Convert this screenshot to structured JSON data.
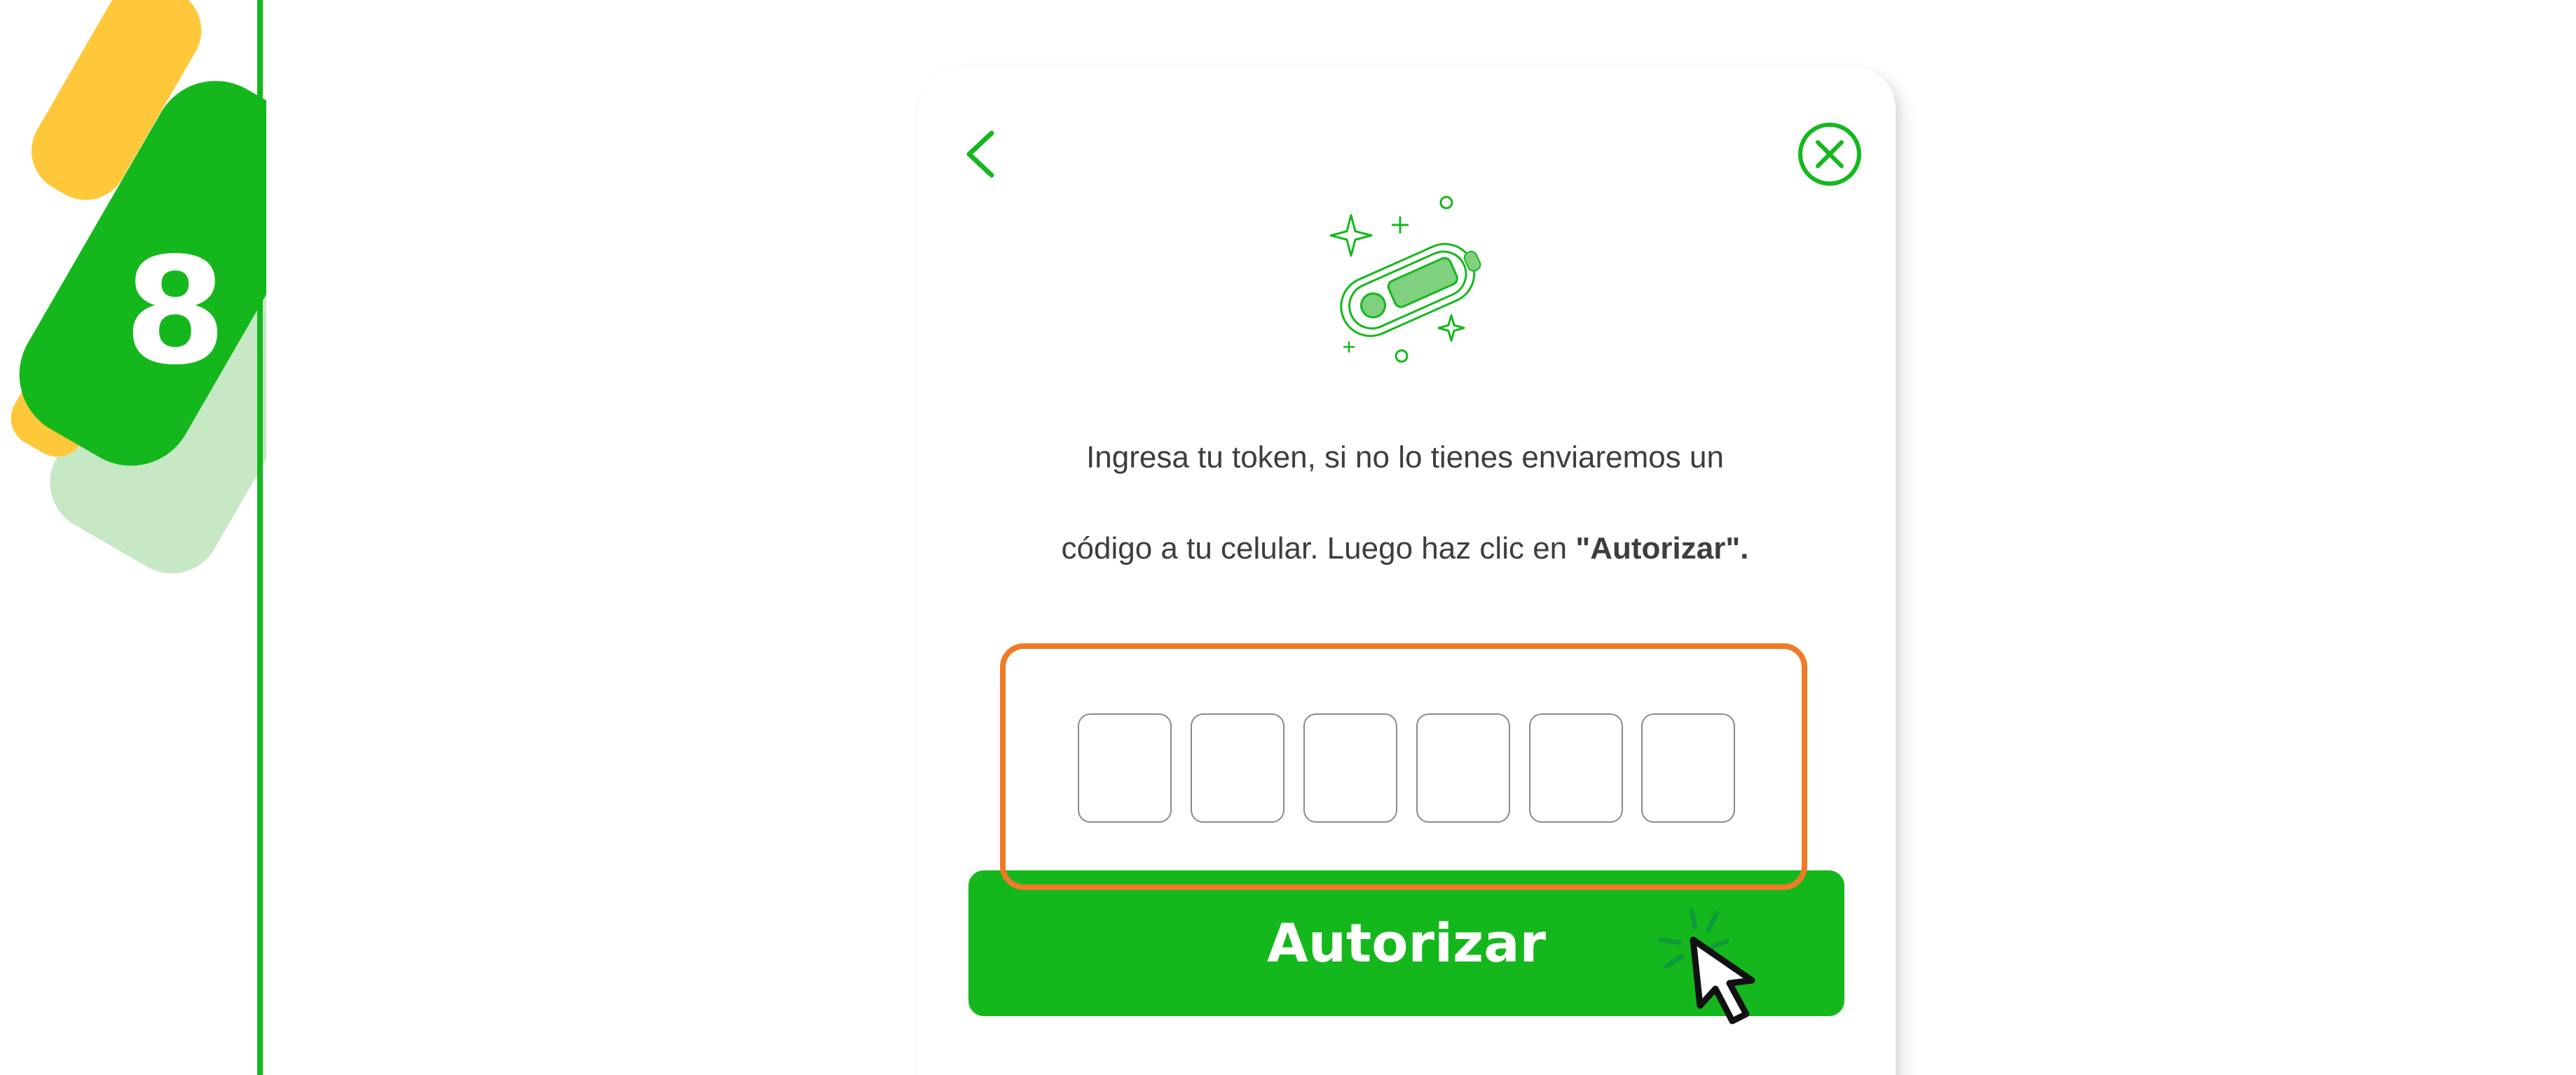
{
  "step": {
    "number": "8"
  },
  "dialog": {
    "instruction_line1": "Ingresa tu token, si no lo tienes enviaremos un",
    "instruction_line2": "código a tu celular. Luego haz clic en ",
    "instruction_bold": "\"Autorizar\".",
    "token_digits": [
      "",
      "",
      "",
      "",
      "",
      ""
    ],
    "authorize_label": "Autorizar"
  },
  "icons": {
    "back": "chevron-left-icon",
    "close": "close-circle-icon",
    "illustration": "token-device-icon",
    "pointer": "mouse-pointer-click-icon"
  },
  "colors": {
    "brand_green": "#14b81c",
    "light_green": "#c7e8c4",
    "accent_yellow": "#ffc83a",
    "highlight_orange": "#f07a26",
    "text": "#3d3d3d"
  }
}
